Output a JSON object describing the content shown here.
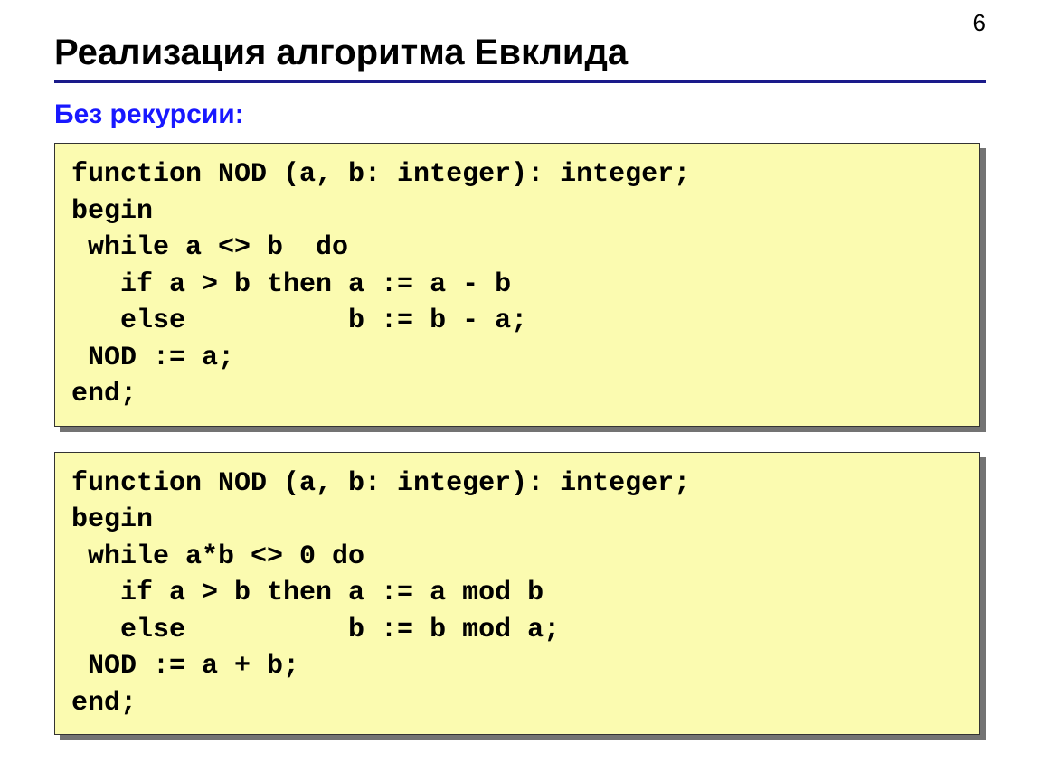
{
  "page_number": "6",
  "title": "Реализация алгоритма Евклида",
  "subheading": "Без рекурсии:",
  "code_block_1": "function NOD (a, b: integer): integer;\nbegin\n while a <> b  do\n   if a > b then a := a - b\n   else          b := b - a;\n NOD := a;\nend;",
  "code_block_2": "function NOD (a, b: integer): integer;\nbegin\n while a*b <> 0 do\n   if a > b then a := a mod b\n   else          b := b mod a;\n NOD := a + b;\nend;"
}
